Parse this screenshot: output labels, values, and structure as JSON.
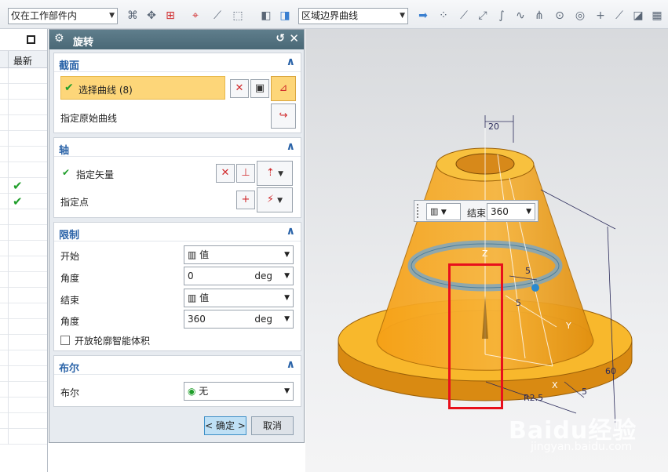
{
  "toolbar": {
    "filter_scope": "仅在工作部件内",
    "curve_rule": "区域边界曲线",
    "accent_color": "#4a6876"
  },
  "left_panel": {
    "column_header": "最新",
    "rows": [
      false,
      false,
      false,
      false,
      false,
      false,
      false,
      true,
      true,
      false,
      false,
      false,
      false,
      false,
      false,
      false,
      false,
      false,
      false,
      false,
      false,
      false,
      false,
      false
    ]
  },
  "dialog": {
    "title": "旋转",
    "section_section": {
      "title": "截面",
      "select_curve": "选择曲线 (8)",
      "specify_origin_curve": "指定原始曲线"
    },
    "section_axis": {
      "title": "轴",
      "specify_vector": "指定矢量",
      "specify_point": "指定点"
    },
    "section_limits": {
      "title": "限制",
      "start_label": "开始",
      "start_mode": "值",
      "start_angle_label": "角度",
      "start_angle_value": "0",
      "start_angle_unit": "deg",
      "end_label": "结束",
      "end_mode": "值",
      "end_angle_label": "角度",
      "end_angle_value": "360",
      "end_angle_unit": "deg",
      "open_profile": "开放轮廓智能体积"
    },
    "section_boolean": {
      "title": "布尔",
      "boolean_label": "布尔",
      "boolean_value": "无"
    },
    "ok_button": "< 确定 >",
    "cancel_button": "取消"
  },
  "viewport": {
    "floating_end_label": "结束",
    "floating_end_value": "360",
    "dims": {
      "d20": "20",
      "d2": "5",
      "d1": "5",
      "d_r": "R2.5",
      "d60": "60",
      "d5b": "5",
      "axis_z": "Z",
      "axis_y": "Y",
      "axis_x": "X"
    },
    "colors": {
      "solid": "#f5a623",
      "highlight_box": "#e8101c"
    }
  },
  "watermark": {
    "brand": "Baidu经验",
    "url": "jingyan.baidu.com"
  }
}
